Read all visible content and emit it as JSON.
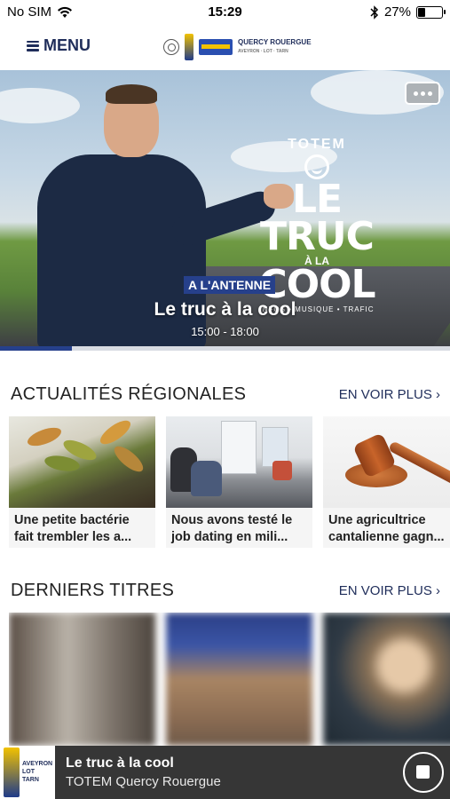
{
  "status_bar": {
    "carrier": "No SIM",
    "time": "15:29",
    "battery": "27%",
    "battery_level": 0.27
  },
  "nav": {
    "menu_label": "MENU",
    "logo_text": "QUERCY ROUERGUE",
    "logo_sub": "AVEYRON · LOT · TARN"
  },
  "hero": {
    "show_logo_top": "TOTEM",
    "show_logo_line1": "LE TRUC",
    "show_logo_line2": "À LA",
    "show_logo_line3": "COOL",
    "show_logo_tags": "INFOS • MUSIQUE • TRAFIC",
    "on_air_label": "A L'ANTENNE",
    "show_title": "Le truc à la cool",
    "show_time": "15:00 - 18:00",
    "progress": 0.16
  },
  "news": {
    "section_title": "ACTUALITÉS RÉGIONALES",
    "more_label": "EN VOIR PLUS ›",
    "items": [
      {
        "caption_line1": "Une petite bactérie",
        "caption_line2": "fait trembler les a..."
      },
      {
        "caption_line1": "Nous avons testé le",
        "caption_line2": "job dating en mili..."
      },
      {
        "caption_line1": "Une agricultrice",
        "caption_line2": "cantalienne gagn..."
      }
    ]
  },
  "titles": {
    "section_title": "DERNIERS TITRES",
    "more_label": "EN VOIR PLUS ›"
  },
  "player": {
    "cover_text_line1": "AVEYRON",
    "cover_text_line2": "LOT",
    "cover_text_line3": "TARN",
    "track": "Le truc à la cool",
    "station": "TOTEM Quercy Rouergue"
  },
  "colors": {
    "brand_blue": "#26408b",
    "nav_text": "#1f2d5a",
    "player_bg": "#363636"
  }
}
